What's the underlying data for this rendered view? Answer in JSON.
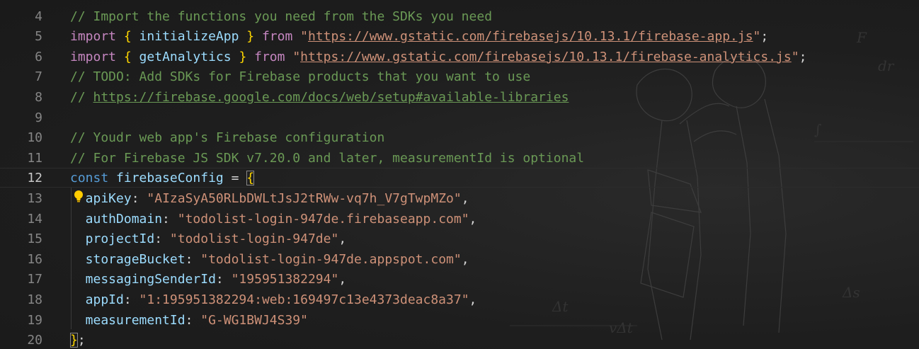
{
  "editor": {
    "current_line": "12",
    "lines": [
      {
        "num": "4",
        "tokens": [
          {
            "t": "// Import the functions you need from the SDKs you need",
            "c": "comment"
          }
        ]
      },
      {
        "num": "5",
        "tokens": [
          {
            "t": "import",
            "c": "kw"
          },
          {
            "t": " ",
            "c": "punct"
          },
          {
            "t": "{",
            "c": "brace"
          },
          {
            "t": " initializeApp ",
            "c": "fn"
          },
          {
            "t": "}",
            "c": "brace"
          },
          {
            "t": " from ",
            "c": "kw"
          },
          {
            "t": "\"",
            "c": "str"
          },
          {
            "t": "https://www.gstatic.com/firebasejs/10.13.1/firebase-app.js",
            "c": "str strlink"
          },
          {
            "t": "\"",
            "c": "str"
          },
          {
            "t": ";",
            "c": "punct"
          }
        ]
      },
      {
        "num": "6",
        "tokens": [
          {
            "t": "import",
            "c": "kw"
          },
          {
            "t": " ",
            "c": "punct"
          },
          {
            "t": "{",
            "c": "brace"
          },
          {
            "t": " getAnalytics ",
            "c": "fn"
          },
          {
            "t": "}",
            "c": "brace"
          },
          {
            "t": " from ",
            "c": "kw"
          },
          {
            "t": "\"",
            "c": "str"
          },
          {
            "t": "https://www.gstatic.com/firebasejs/10.13.1/firebase-analytics.js",
            "c": "str strlink"
          },
          {
            "t": "\"",
            "c": "str"
          },
          {
            "t": ";",
            "c": "punct"
          }
        ]
      },
      {
        "num": "7",
        "tokens": [
          {
            "t": "// TODO: Add SDKs for Firebase products that you want to use",
            "c": "comment"
          }
        ]
      },
      {
        "num": "8",
        "tokens": [
          {
            "t": "// ",
            "c": "comment"
          },
          {
            "t": "https://firebase.google.com/docs/web/setup#available-libraries",
            "c": "comment link"
          }
        ]
      },
      {
        "num": "9",
        "tokens": []
      },
      {
        "num": "10",
        "tokens": [
          {
            "t": "// Youdr web app's Firebase configuration",
            "c": "comment"
          }
        ]
      },
      {
        "num": "11",
        "tokens": [
          {
            "t": "// For Firebase JS SDK v7.20.0 and later, measurementId is optional",
            "c": "comment"
          }
        ]
      },
      {
        "num": "12",
        "tokens": [
          {
            "t": "const",
            "c": "decl"
          },
          {
            "t": " firebaseConfig",
            "c": "var"
          },
          {
            "t": " = ",
            "c": "punct"
          },
          {
            "t": "{",
            "c": "brace-hl"
          }
        ]
      },
      {
        "num": "13",
        "tokens": [
          {
            "t": "  apiKey",
            "c": "var"
          },
          {
            "t": ": ",
            "c": "punct"
          },
          {
            "t": "\"AIzaSyA50RLbDWLtJsJ2tRWw-vq7h_V7gTwpMZo\"",
            "c": "str"
          },
          {
            "t": ",",
            "c": "punct"
          }
        ]
      },
      {
        "num": "14",
        "tokens": [
          {
            "t": "  authDomain",
            "c": "var"
          },
          {
            "t": ": ",
            "c": "punct"
          },
          {
            "t": "\"todolist-login-947de.firebaseapp.com\"",
            "c": "str"
          },
          {
            "t": ",",
            "c": "punct"
          }
        ]
      },
      {
        "num": "15",
        "tokens": [
          {
            "t": "  projectId",
            "c": "var"
          },
          {
            "t": ": ",
            "c": "punct"
          },
          {
            "t": "\"todolist-login-947de\"",
            "c": "str"
          },
          {
            "t": ",",
            "c": "punct"
          }
        ]
      },
      {
        "num": "16",
        "tokens": [
          {
            "t": "  storageBucket",
            "c": "var"
          },
          {
            "t": ": ",
            "c": "punct"
          },
          {
            "t": "\"todolist-login-947de.appspot.com\"",
            "c": "str"
          },
          {
            "t": ",",
            "c": "punct"
          }
        ]
      },
      {
        "num": "17",
        "tokens": [
          {
            "t": "  messagingSenderId",
            "c": "var"
          },
          {
            "t": ": ",
            "c": "punct"
          },
          {
            "t": "\"195951382294\"",
            "c": "str"
          },
          {
            "t": ",",
            "c": "punct"
          }
        ]
      },
      {
        "num": "18",
        "tokens": [
          {
            "t": "  appId",
            "c": "var"
          },
          {
            "t": ": ",
            "c": "punct"
          },
          {
            "t": "\"1:195951382294:web:169497c13e4373deac8a37\"",
            "c": "str"
          },
          {
            "t": ",",
            "c": "punct"
          }
        ]
      },
      {
        "num": "19",
        "tokens": [
          {
            "t": "  measurementId",
            "c": "var"
          },
          {
            "t": ": ",
            "c": "punct"
          },
          {
            "t": "\"G-WG1BWJ4S39\"",
            "c": "str"
          }
        ]
      },
      {
        "num": "20",
        "tokens": [
          {
            "t": "}",
            "c": "brace-hl"
          },
          {
            "t": ";",
            "c": "punct"
          }
        ]
      }
    ],
    "lightbulb_icon": "lightbulb-icon",
    "colors": {
      "comment": "#6a9955",
      "keyword": "#c586c0",
      "declaration": "#569cd6",
      "variable": "#9cdcfe",
      "string": "#ce9178",
      "brace": "#ffd700",
      "background": "#1e1e1e"
    }
  }
}
